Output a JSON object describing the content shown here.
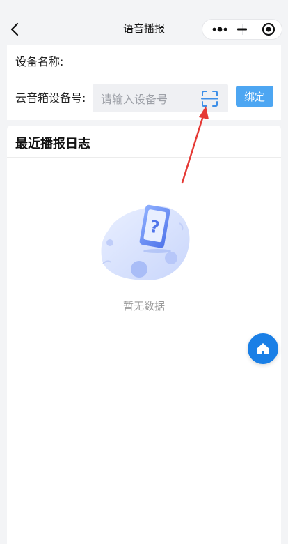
{
  "nav": {
    "title": "语音播报",
    "icons": [
      "back-arrow-icon",
      "more-dots-icon",
      "minimize-icon",
      "target-circle-icon"
    ]
  },
  "form": {
    "device_name_label": "设备名称:",
    "device_no_label": "云音箱设备号:",
    "device_no_placeholder": "请输入设备号",
    "device_no_value": "",
    "scan_icon": "scan-qrcode-icon",
    "bind_button": "绑定"
  },
  "log": {
    "title": "最近播报日志",
    "empty_text": "暂无数据",
    "empty_icon": "empty-question-phone-illustration"
  },
  "fab": {
    "icon": "home-icon"
  },
  "colors": {
    "accent": "#4da6f2",
    "fab": "#1a7fe6",
    "annotation": "#e53935",
    "background": "#f3f4f6"
  }
}
